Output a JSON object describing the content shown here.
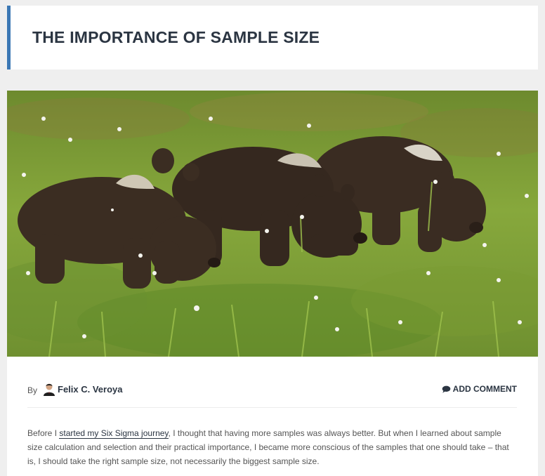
{
  "header": {
    "title": "THE IMPORTANCE OF SAMPLE SIZE"
  },
  "hero": {
    "image_subject": "three brown bear cubs walking through grass"
  },
  "meta": {
    "by_label": "By",
    "author_name": "Felix C. Veroya",
    "comment_icon": "comment-icon",
    "add_comment_label": "ADD COMMENT"
  },
  "article": {
    "para_before": "Before I ",
    "link_text": "started my Six Sigma journey",
    "para_after": ", I thought that having more samples was always better. But when I learned about sample size calculation and selection and their practical importance, I became more conscious of the samples that one should take – that is, I should take the right sample size, not necessarily the biggest sample size."
  },
  "colors": {
    "accent": "#3c78b5",
    "title": "#2b3542",
    "background": "#efefef"
  }
}
